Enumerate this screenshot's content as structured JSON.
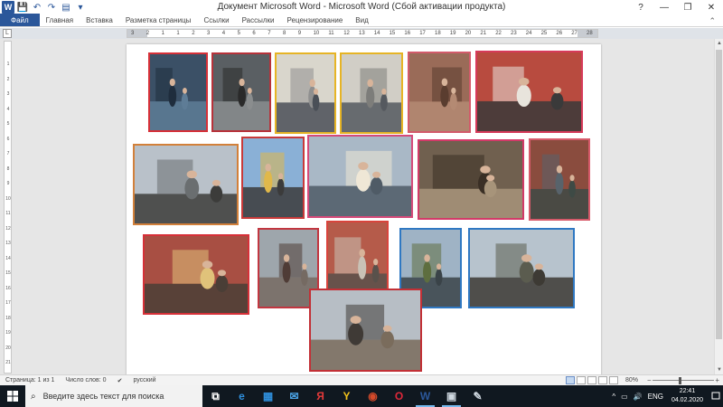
{
  "titlebar": {
    "title": "Документ Microsoft Word - Microsoft Word (Сбой активации продукта)",
    "word_icon_letter": "W",
    "controls": {
      "minimize": "—",
      "maximize": "❐",
      "close": "✕",
      "help": "?"
    }
  },
  "ribbon": {
    "tabs": [
      "Файл",
      "Главная",
      "Вставка",
      "Разметка страницы",
      "Ссылки",
      "Рассылки",
      "Рецензирование",
      "Вид"
    ],
    "active_tab": "Файл",
    "collapse_glyph": "⌃"
  },
  "ruler": {
    "corner_glyph": "L",
    "labels": [
      "3",
      "2",
      "1",
      "1",
      "2",
      "3",
      "4",
      "5",
      "6",
      "7",
      "8",
      "9",
      "10",
      "11",
      "12",
      "13",
      "14",
      "15",
      "16",
      "17",
      "18",
      "19",
      "20",
      "21",
      "22",
      "23",
      "24",
      "25",
      "26",
      "27",
      "28"
    ],
    "vlabels": [
      "1",
      "2",
      "3",
      "4",
      "5",
      "6",
      "7",
      "8",
      "9",
      "10",
      "11",
      "12",
      "13",
      "14",
      "15",
      "16",
      "17",
      "18",
      "19",
      "20",
      "21"
    ]
  },
  "photos": [
    {
      "id": "p1",
      "frame": "#d63038",
      "palette": [
        "#3b5066",
        "#1f2d3d",
        "#5e7c96"
      ],
      "subject": "boy-fence"
    },
    {
      "id": "p2",
      "frame": "#b8323a",
      "palette": [
        "#5a5f63",
        "#2a2a2a",
        "#8a8d8e"
      ],
      "subject": "woman-selfie"
    },
    {
      "id": "p3",
      "frame": "#e6b425",
      "palette": [
        "#d9d6cc",
        "#8f8f8f",
        "#4a4f57"
      ],
      "subject": "gate"
    },
    {
      "id": "p4",
      "frame": "#e6b425",
      "palette": [
        "#d1cec6",
        "#7d7d7a",
        "#55595f"
      ],
      "subject": "gate"
    },
    {
      "id": "p5",
      "frame": "#d35a6a",
      "palette": [
        "#9a6b58",
        "#5a3d2f",
        "#b48a73"
      ],
      "subject": "bunny"
    },
    {
      "id": "p6",
      "frame": "#d63a5a",
      "palette": [
        "#b84b3f",
        "#e8e4dc",
        "#3a3a3a"
      ],
      "subject": "bench-family"
    },
    {
      "id": "p7",
      "frame": "#d2803a",
      "palette": [
        "#b9c1c9",
        "#6a6e70",
        "#3c3c3a"
      ],
      "subject": "statue"
    },
    {
      "id": "p8",
      "frame": "#c93a3a",
      "palette": [
        "#8ab0d6",
        "#e0b84a",
        "#3b3b3b"
      ],
      "subject": "spire"
    },
    {
      "id": "p9",
      "frame": "#d64a7a",
      "palette": [
        "#a9b8c6",
        "#efe7d6",
        "#4f5b66"
      ],
      "subject": "pavilion"
    },
    {
      "id": "p10",
      "frame": "#d23a68",
      "palette": [
        "#70604f",
        "#3a2f25",
        "#a7947a"
      ],
      "subject": "boat"
    },
    {
      "id": "p11",
      "frame": "#d65a6a",
      "palette": [
        "#8a4c3e",
        "#58636b",
        "#3e4a45"
      ],
      "subject": "brick-wall"
    },
    {
      "id": "p12",
      "frame": "#d63038",
      "palette": [
        "#a84f43",
        "#e0c27a",
        "#4a3e36"
      ],
      "subject": "bunnies-wall"
    },
    {
      "id": "p13",
      "frame": "#c23640",
      "palette": [
        "#9ea6ac",
        "#4f3c36",
        "#756a62"
      ],
      "subject": "bunny-statue"
    },
    {
      "id": "p14",
      "frame": "#d8443c",
      "palette": [
        "#b55b4a",
        "#c9c2b6",
        "#59514b"
      ],
      "subject": "bunny-family"
    },
    {
      "id": "p15",
      "frame": "#2f78c2",
      "palette": [
        "#9fb3c5",
        "#5e6e3f",
        "#3a4348"
      ],
      "subject": "alley"
    },
    {
      "id": "p16",
      "frame": "#2f78c2",
      "palette": [
        "#b7c3cd",
        "#5b5c4f",
        "#3d3a34"
      ],
      "subject": "trees"
    },
    {
      "id": "p17",
      "frame": "#c23036",
      "palette": [
        "#b7bec5",
        "#3f3a36",
        "#7a6c5c"
      ],
      "subject": "sundial"
    }
  ],
  "statusbar": {
    "page": "Страница: 1 из 1",
    "words": "Число слов: 0",
    "lang": "русский",
    "zoom": "80%",
    "zoom_fraction": 0.44
  },
  "taskbar": {
    "search_placeholder": "Введите здесь текст для поиска",
    "apps": [
      {
        "name": "task-view",
        "glyph": "⧉",
        "color": "#ffffff"
      },
      {
        "name": "edge",
        "glyph": "e",
        "color": "#2f8fdc"
      },
      {
        "name": "store",
        "glyph": "▦",
        "color": "#2f8fdc"
      },
      {
        "name": "mail",
        "glyph": "✉",
        "color": "#4aa3e6"
      },
      {
        "name": "yandex",
        "glyph": "Я",
        "color": "#e43a3a"
      },
      {
        "name": "yandex-browser",
        "glyph": "Y",
        "color": "#f2c21b"
      },
      {
        "name": "media",
        "glyph": "◉",
        "color": "#d54a2a"
      },
      {
        "name": "opera",
        "glyph": "O",
        "color": "#e0283a"
      },
      {
        "name": "word",
        "glyph": "W",
        "color": "#2b579a",
        "active": true
      },
      {
        "name": "photos",
        "glyph": "▣",
        "color": "#cfd8e0",
        "active": true
      },
      {
        "name": "paint",
        "glyph": "✎",
        "color": "#cfd8e0"
      }
    ],
    "tray": {
      "caret": "^",
      "net": "▭",
      "volume": "🔊",
      "lang": "ENG",
      "time": "22:41",
      "date": "04.02.2020"
    }
  }
}
